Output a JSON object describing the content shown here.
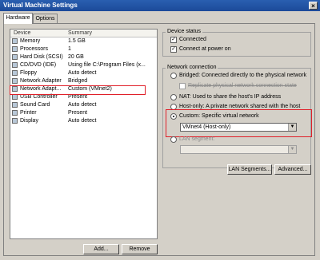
{
  "window": {
    "title": "Virtual Machine Settings"
  },
  "tabs": [
    {
      "label": "Hardware"
    },
    {
      "label": "Options"
    }
  ],
  "device_list": {
    "headers": {
      "device": "Device",
      "summary": "Summary"
    },
    "rows": [
      {
        "device": "Memory",
        "summary": "1.5 GB",
        "icon": "memory-icon"
      },
      {
        "device": "Processors",
        "summary": "1",
        "icon": "processor-icon"
      },
      {
        "device": "Hard Disk (SCSI)",
        "summary": "20 GB",
        "icon": "hard-disk-icon"
      },
      {
        "device": "CD/DVD (IDE)",
        "summary": "Using file C:\\Program Files (x...",
        "icon": "cd-dvd-icon"
      },
      {
        "device": "Floppy",
        "summary": "Auto detect",
        "icon": "floppy-icon"
      },
      {
        "device": "Network Adapter",
        "summary": "Bridged",
        "icon": "network-icon"
      },
      {
        "device": "Network Adapt...",
        "summary": "Custom (VMnet2)",
        "icon": "network-icon"
      },
      {
        "device": "USB Controller",
        "summary": "Present",
        "icon": "usb-icon"
      },
      {
        "device": "Sound Card",
        "summary": "Auto detect",
        "icon": "sound-icon"
      },
      {
        "device": "Printer",
        "summary": "Present",
        "icon": "printer-icon"
      },
      {
        "device": "Display",
        "summary": "Auto detect",
        "icon": "display-icon"
      }
    ]
  },
  "buttons": {
    "add": "Add...",
    "remove": "Remove",
    "lan_segments": "LAN Segments...",
    "advanced": "Advanced..."
  },
  "device_status": {
    "title": "Device status",
    "connected": "Connected",
    "connect_at_power_on": "Connect at power on"
  },
  "network_connection": {
    "title": "Network connection",
    "bridged": "Bridged: Connected directly to the physical network",
    "replicate": "Replicate physical network connection state",
    "nat": "NAT: Used to share the host's IP address",
    "host_only": "Host-only: A private network shared with the host",
    "custom": "Custom: Specific virtual network",
    "custom_value": "VMnet4 (Host-only)",
    "lan_segment": "LAN segment:"
  },
  "colors": {
    "title_bar": "#1c4a99",
    "highlight": "#e0202a"
  }
}
